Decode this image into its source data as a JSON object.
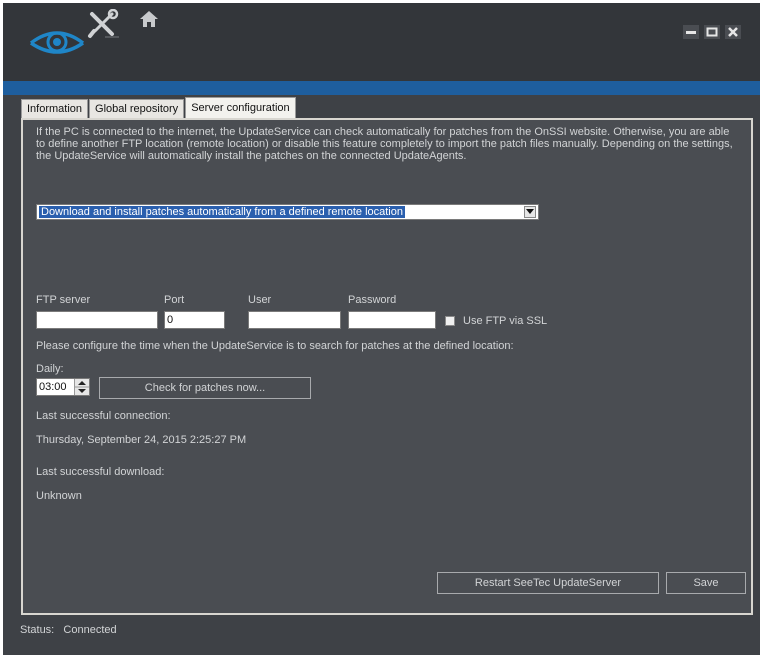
{
  "tabs": [
    {
      "label": "Information"
    },
    {
      "label": "Global repository"
    },
    {
      "label": "Server configuration"
    }
  ],
  "description": "If the PC is connected to the internet, the UpdateService can check automatically for patches from the OnSSI website. Otherwise, you are able to define another FTP location (remote location) or disable this feature completely to import the patch files manually. Depending on the settings, the UpdateService will automatically install the patches on the connected UpdateAgents.",
  "mode_select": {
    "value": "Download and install patches automatically from a defined remote location"
  },
  "ftp": {
    "server_label": "FTP server",
    "port_label": "Port",
    "user_label": "User",
    "password_label": "Password",
    "server_value": "",
    "port_value": "0",
    "user_value": "",
    "password_value": "",
    "use_ssl_label": "Use FTP via SSL",
    "use_ssl_checked": false
  },
  "schedule": {
    "instruction": "Please configure the time when the UpdateService is to search for patches at the defined location:",
    "daily_label": "Daily:",
    "time_value": "03:00",
    "check_button": "Check for patches now..."
  },
  "last_connection": {
    "label": "Last successful connection:",
    "value": "Thursday, September 24, 2015 2:25:27 PM"
  },
  "last_download": {
    "label": "Last successful download:",
    "value": "Unknown"
  },
  "buttons": {
    "restart": "Restart SeeTec UpdateServer",
    "save": "Save"
  },
  "status": {
    "label": "Status:",
    "value": "Connected"
  },
  "icons": [
    "eye-logo-icon",
    "tools-icon",
    "home-icon",
    "minimize-icon",
    "maximize-icon",
    "close-icon"
  ],
  "colors": {
    "window_bg": "#3e4146",
    "accent_bar": "#1e5e9e",
    "selection": "#2a5fae"
  }
}
